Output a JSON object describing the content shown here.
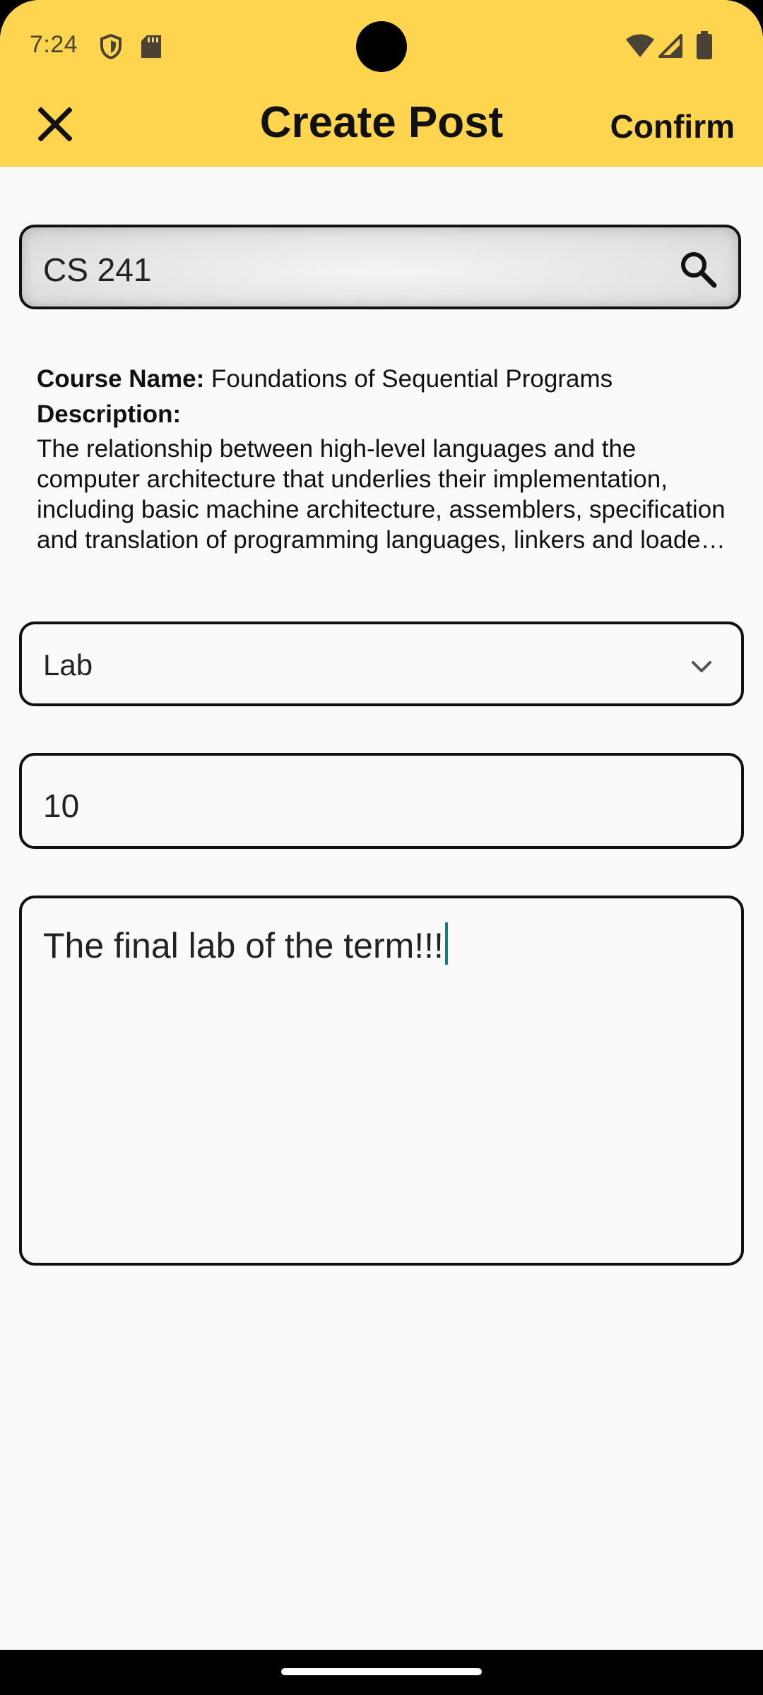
{
  "status_bar": {
    "time": "7:24",
    "icons": [
      "shield-icon",
      "sd-card-icon",
      "wifi-icon",
      "signal-icon",
      "battery-icon"
    ]
  },
  "app_bar": {
    "title": "Create Post",
    "close_icon": "close-icon",
    "confirm_label": "Confirm",
    "background_color": "#ffd54f"
  },
  "course_search": {
    "value": "CS 241",
    "icon": "search-icon"
  },
  "course_info": {
    "name_label": "Course Name:",
    "name_value": " Foundations of Sequential Programs",
    "description_label": "Description:",
    "description": "The relationship between high-level languages and the computer architecture that underlies their implementation, including basic machine architecture, assemblers, specification and translation of programming languages, linkers and loaders, block-structured languages, parameter passing mechanisms, and comparison of programming languages."
  },
  "post_type": {
    "selected": "Lab",
    "icon": "chevron-down-icon"
  },
  "number_field": {
    "value": "10"
  },
  "post_body": {
    "value": "The final lab of the term!!!"
  },
  "colors": {
    "accent": "#ffd54f",
    "caret": "#1e7b7b",
    "background": "#fafafa"
  }
}
